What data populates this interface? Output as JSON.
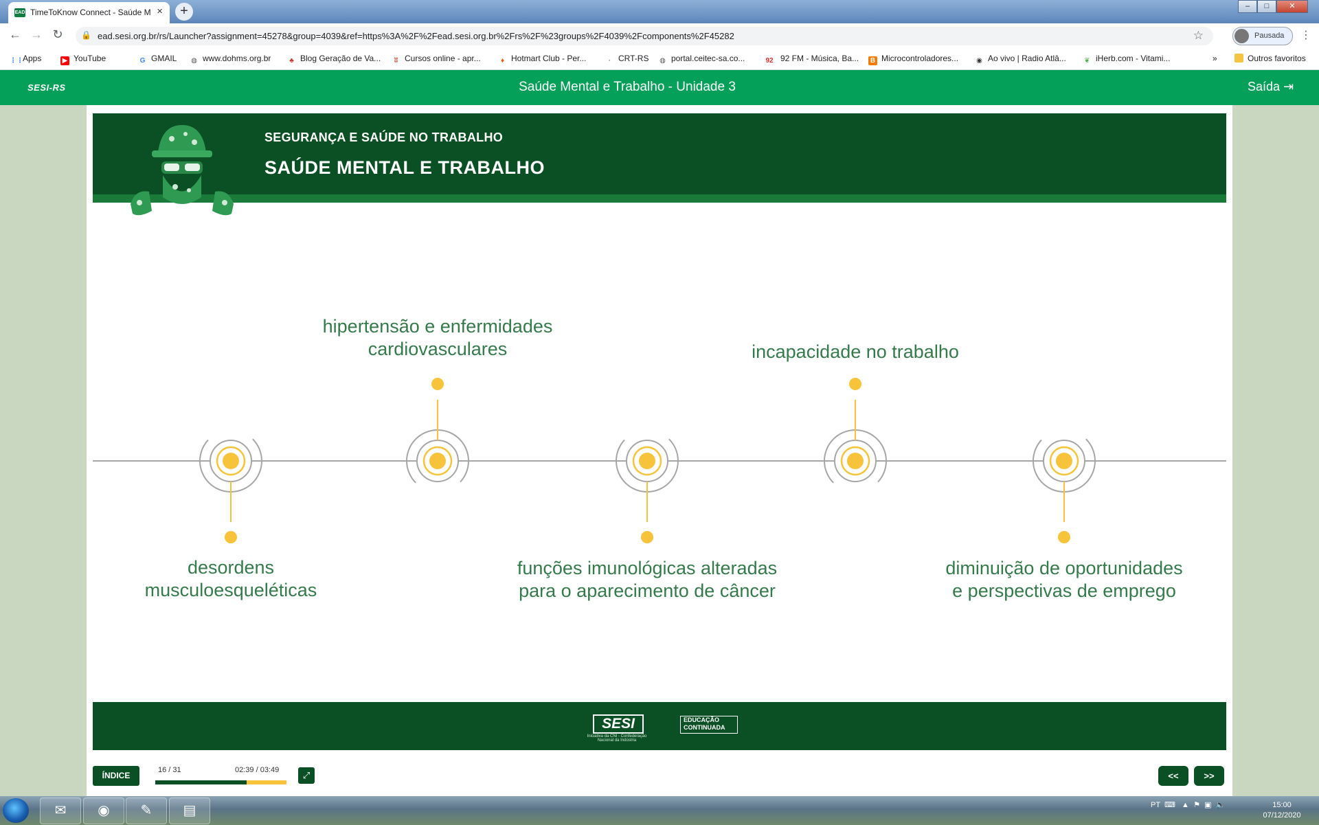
{
  "browser": {
    "tab_title": "TimeToKnow Connect - Saúde M",
    "tab_favicon": "EAD",
    "url": "ead.sesi.org.br/rs/Launcher?assignment=45278&group=4039&ref=https%3A%2F%2Fead.sesi.org.br%2Frs%2F%23groups%2F4039%2Fcomponents%2F45282",
    "profile_label": "Pausada",
    "bookmarks": [
      {
        "label": "Apps",
        "icon": "apps-grid-icon",
        "color": "#4285f4"
      },
      {
        "label": "YouTube",
        "icon": "youtube-icon",
        "color": "#ff0000"
      },
      {
        "label": "GMAIL",
        "icon": "google-icon",
        "color": "#4285f4"
      },
      {
        "label": "www.dohms.org.br",
        "icon": "globe-icon",
        "color": "#555555"
      },
      {
        "label": "Blog Geração de Va...",
        "icon": "blog-icon",
        "color": "#c0392b"
      },
      {
        "label": "Cursos online - apr...",
        "icon": "hotmart-icon",
        "color": "#e74c3c"
      },
      {
        "label": "Hotmart Club - Per...",
        "icon": "flame-icon",
        "color": "#e8590c"
      },
      {
        "label": "CRT-RS",
        "icon": "crt-icon",
        "color": "#888888"
      },
      {
        "label": "portal.ceitec-sa.co...",
        "icon": "globe-icon",
        "color": "#555555"
      },
      {
        "label": "92 FM - Música, Ba...",
        "icon": "radio-92-icon",
        "color": "#d32f2f"
      },
      {
        "label": "Microcontroladores...",
        "icon": "blogger-icon",
        "color": "#f57c00"
      },
      {
        "label": "Ao vivo | Radio Atlâ...",
        "icon": "radio-icon",
        "color": "#333333"
      },
      {
        "label": "iHerb.com - Vitami...",
        "icon": "leaf-icon",
        "color": "#4caf50"
      }
    ],
    "bookmarks_overflow": "»",
    "other_bookmarks": "Outros favoritos"
  },
  "lms": {
    "brand": "SESI-RS",
    "title": "Saúde Mental e Trabalho - Unidade 3",
    "exit_label": "Saída"
  },
  "slide": {
    "subtitle": "SEGURANÇA E SAÚDE NO TRABALHO",
    "title": "SAÚDE MENTAL E TRABALHO",
    "items": [
      {
        "text": "desordens musculoesqueléticas",
        "position": "below"
      },
      {
        "text": "hipertensão e enfermidades cardiovasculares",
        "position": "above"
      },
      {
        "text": "funções imunológicas alteradas para o aparecimento de câncer",
        "position": "below"
      },
      {
        "text": "incapacidade no trabalho",
        "position": "above"
      },
      {
        "text": "diminuição de oportunidades e perspectivas de emprego",
        "position": "below"
      }
    ],
    "labels": {
      "item1": [
        "desordens",
        "musculoesqueléticas"
      ],
      "item2": [
        "hipertensão e enfermidades",
        "cardiovasculares"
      ],
      "item3": [
        "funções imunológicas alteradas",
        "para o aparecimento de câncer"
      ],
      "item4": [
        "incapacidade no trabalho"
      ],
      "item5": [
        "diminuição de oportunidades",
        "e perspectivas de emprego"
      ]
    },
    "footer": {
      "sesi_logo": "SESI",
      "sesi_caption": "Iniciativa da CNI - Confederação Nacional da Indústria",
      "edu_logo_line1": "EDUCAÇÃO",
      "edu_logo_line2": "CONTINUADA"
    },
    "colors": {
      "header": "#0b4f24",
      "accent": "#f6c33b",
      "text": "#357a4b",
      "ring": "#a6a6a6"
    }
  },
  "player": {
    "index_label": "ÍNDICE",
    "page": "16 / 31",
    "time": "02:39 / 03:49",
    "progress_fraction": 0.694,
    "prev_label": "<<",
    "next_label": ">>"
  },
  "taskbar": {
    "language": "PT",
    "time": "15:00",
    "date": "07/12/2020"
  }
}
